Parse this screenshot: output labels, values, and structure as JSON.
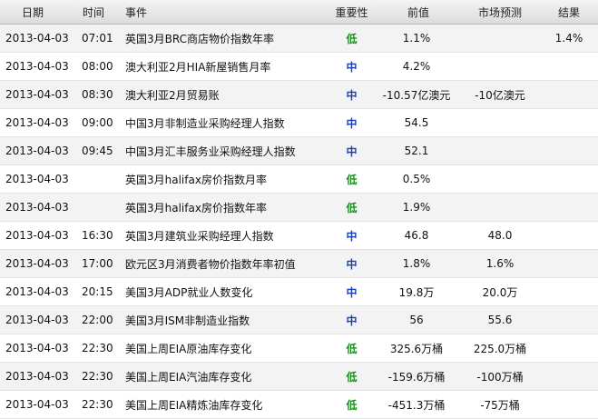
{
  "headers": {
    "date": "日期",
    "time": "时间",
    "event": "事件",
    "importance": "重要性",
    "previous": "前值",
    "forecast": "市场预测",
    "actual": "结果"
  },
  "importance_colors": {
    "低": "#1a8f1a",
    "中": "#1540c8"
  },
  "rows": [
    {
      "date": "2013-04-03",
      "time": "07:01",
      "event": "英国3月BRC商店物价指数年率",
      "importance": "低",
      "level": "low",
      "previous": "1.1%",
      "forecast": "",
      "actual": "1.4%"
    },
    {
      "date": "2013-04-03",
      "time": "08:00",
      "event": "澳大利亚2月HIA新屋销售月率",
      "importance": "中",
      "level": "mid",
      "previous": "4.2%",
      "forecast": "",
      "actual": ""
    },
    {
      "date": "2013-04-03",
      "time": "08:30",
      "event": "澳大利亚2月贸易账",
      "importance": "中",
      "level": "mid",
      "previous": "-10.57亿澳元",
      "forecast": "-10亿澳元",
      "actual": ""
    },
    {
      "date": "2013-04-03",
      "time": "09:00",
      "event": "中国3月非制造业采购经理人指数",
      "importance": "中",
      "level": "mid",
      "previous": "54.5",
      "forecast": "",
      "actual": ""
    },
    {
      "date": "2013-04-03",
      "time": "09:45",
      "event": "中国3月汇丰服务业采购经理人指数",
      "importance": "中",
      "level": "mid",
      "previous": "52.1",
      "forecast": "",
      "actual": ""
    },
    {
      "date": "2013-04-03",
      "time": "",
      "event": "英国3月halifax房价指数月率",
      "importance": "低",
      "level": "low",
      "previous": "0.5%",
      "forecast": "",
      "actual": ""
    },
    {
      "date": "2013-04-03",
      "time": "",
      "event": "英国3月halifax房价指数年率",
      "importance": "低",
      "level": "low",
      "previous": "1.9%",
      "forecast": "",
      "actual": ""
    },
    {
      "date": "2013-04-03",
      "time": "16:30",
      "event": "英国3月建筑业采购经理人指数",
      "importance": "中",
      "level": "mid",
      "previous": "46.8",
      "forecast": "48.0",
      "actual": ""
    },
    {
      "date": "2013-04-03",
      "time": "17:00",
      "event": "欧元区3月消费者物价指数年率初值",
      "importance": "中",
      "level": "mid",
      "previous": "1.8%",
      "forecast": "1.6%",
      "actual": ""
    },
    {
      "date": "2013-04-03",
      "time": "20:15",
      "event": "美国3月ADP就业人数变化",
      "importance": "中",
      "level": "mid",
      "previous": "19.8万",
      "forecast": "20.0万",
      "actual": ""
    },
    {
      "date": "2013-04-03",
      "time": "22:00",
      "event": "美国3月ISM非制造业指数",
      "importance": "中",
      "level": "mid",
      "previous": "56",
      "forecast": "55.6",
      "actual": ""
    },
    {
      "date": "2013-04-03",
      "time": "22:30",
      "event": "美国上周EIA原油库存变化",
      "importance": "低",
      "level": "low",
      "previous": "325.6万桶",
      "forecast": "225.0万桶",
      "actual": ""
    },
    {
      "date": "2013-04-03",
      "time": "22:30",
      "event": "美国上周EIA汽油库存变化",
      "importance": "低",
      "level": "low",
      "previous": "-159.6万桶",
      "forecast": "-100万桶",
      "actual": ""
    },
    {
      "date": "2013-04-03",
      "time": "22:30",
      "event": "美国上周EIA精炼油库存变化",
      "importance": "低",
      "level": "low",
      "previous": "-451.3万桶",
      "forecast": "-75万桶",
      "actual": ""
    }
  ]
}
